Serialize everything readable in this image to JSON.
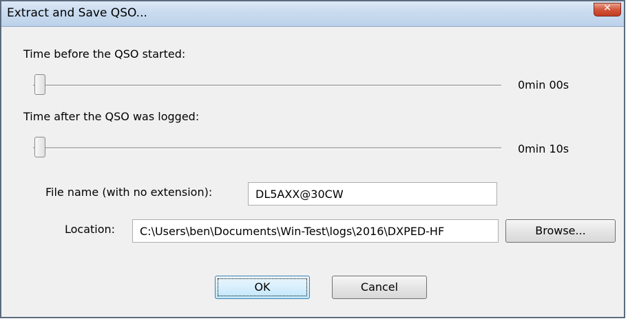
{
  "window": {
    "title": "Extract and Save QSO...",
    "close_glyph": "✕"
  },
  "before": {
    "label": "Time before the QSO started:",
    "value": "0min 00s",
    "slider_level": 0
  },
  "after": {
    "label": "Time after the QSO was logged:",
    "value": "0min 10s",
    "slider_level": 0
  },
  "file": {
    "label": "File name (with no extension):",
    "value": "DL5AXX@30CW"
  },
  "location": {
    "label": "Location:",
    "value": "C:\\Users\\ben\\Documents\\Win-Test\\logs\\2016\\DXPED-HF",
    "browse_label": "Browse..."
  },
  "buttons": {
    "ok_label": "OK",
    "cancel_label": "Cancel"
  }
}
